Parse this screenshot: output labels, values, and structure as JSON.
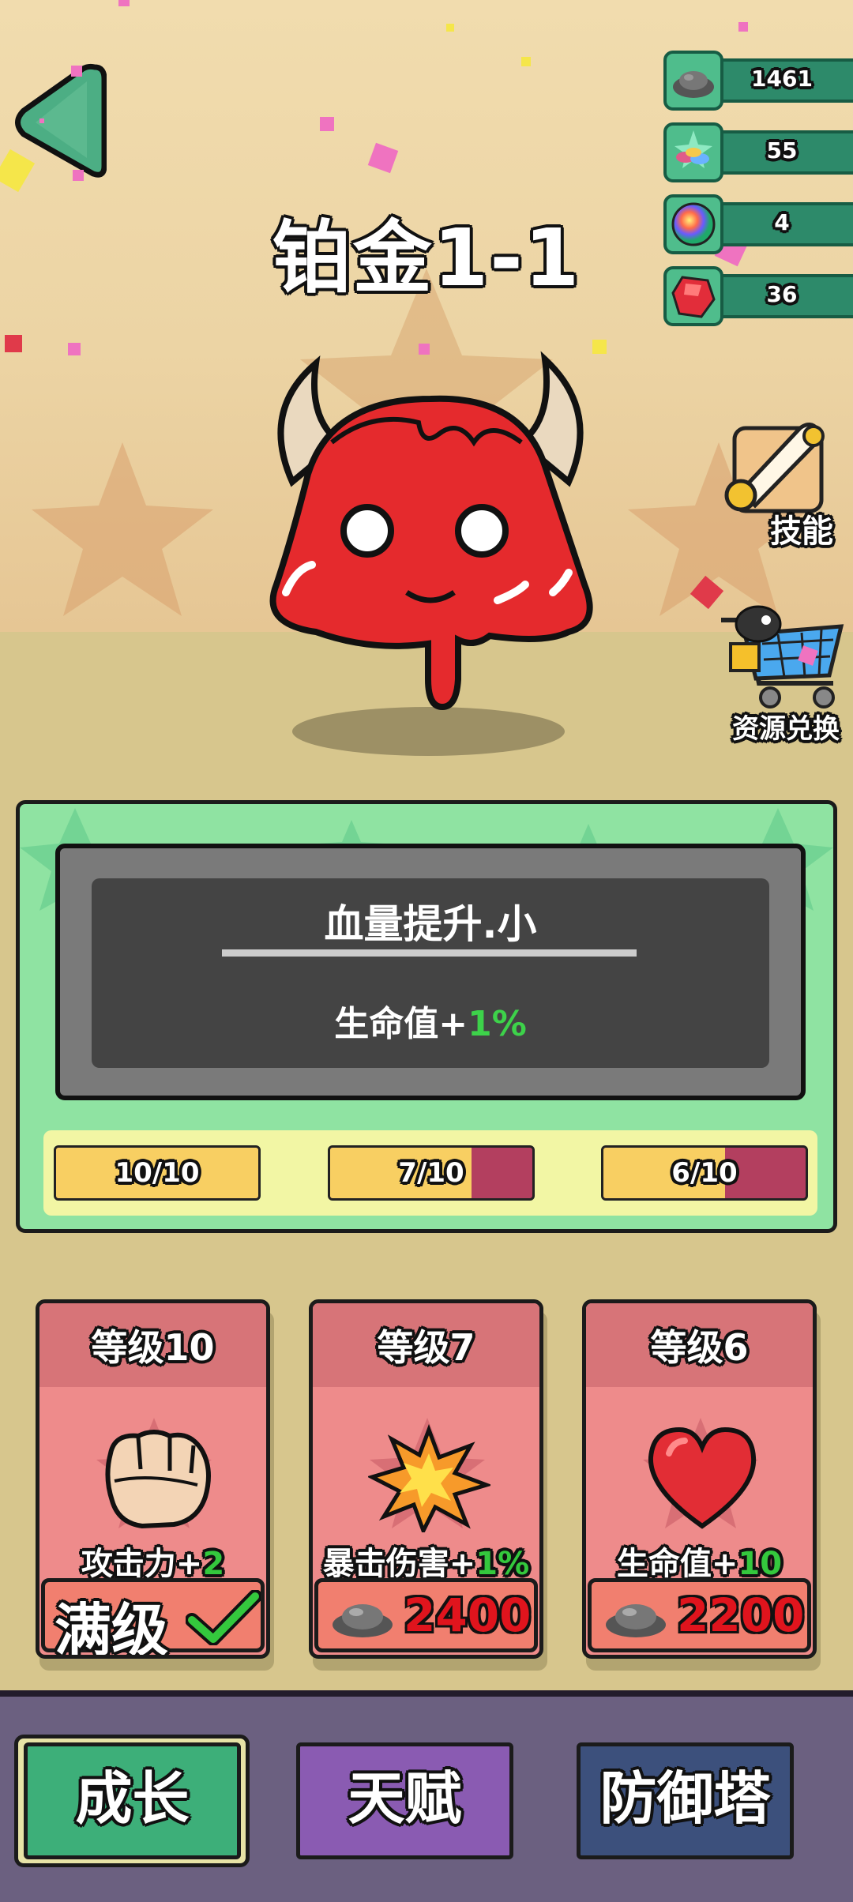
{
  "level_title": "铂金1-1",
  "resources": [
    {
      "icon": "ore-pile-icon",
      "value": "1461"
    },
    {
      "icon": "gem-pile-icon",
      "value": "55"
    },
    {
      "icon": "rainbow-orb-icon",
      "value": "4"
    },
    {
      "icon": "red-crystal-icon",
      "value": "36"
    }
  ],
  "side_buttons": {
    "skills_label": "技能",
    "exchange_label": "资源兑换"
  },
  "skill_panel": {
    "name": "血量提升.小",
    "desc_prefix": "生命值+",
    "desc_value": "1%"
  },
  "progress": [
    {
      "label": "10/10",
      "fraction": 1.0
    },
    {
      "label": "7/10",
      "fraction": 0.7
    },
    {
      "label": "6/10",
      "fraction": 0.6
    }
  ],
  "cards": [
    {
      "level": "等级10",
      "bonus_prefix": "攻击力+",
      "bonus_value": "2",
      "footer": "满级",
      "icon": "fist-icon"
    },
    {
      "level": "等级7",
      "bonus_prefix": "暴击伤害+",
      "bonus_value": "1%",
      "cost": "2400",
      "icon": "explosion-icon"
    },
    {
      "level": "等级6",
      "bonus_prefix": "生命值+",
      "bonus_value": "10",
      "cost": "2200",
      "icon": "heart-icon"
    }
  ],
  "nav_tabs": [
    "成长",
    "天赋",
    "防御塔"
  ],
  "colors": {
    "panel_green": "#8fe3a2",
    "card_pink": "#ee8b8b",
    "cost_red": "#e0141d",
    "bonus_green": "#34c83d",
    "tab_growth": "#3daf79",
    "tab_talent": "#8a5bb2",
    "tab_tower": "#3c507c"
  }
}
